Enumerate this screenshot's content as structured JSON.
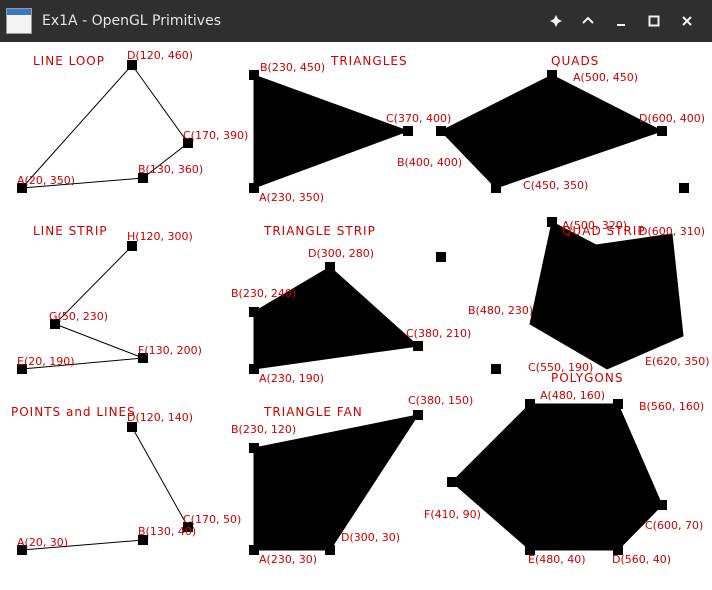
{
  "window": {
    "title": "Ex1A - OpenGL Primitives",
    "controls": [
      "pin",
      "minimize-up",
      "minimize",
      "maximize",
      "close"
    ],
    "colors": {
      "titlebar": "#2f2f2f",
      "label": "#cc0000",
      "shape": "#000000"
    }
  },
  "scene": {
    "titles": {
      "line_loop": "LINE LOOP",
      "triangles": "TRIANGLES",
      "quads": "QUADS",
      "line_strip": "LINE STRIP",
      "triangle_strip": "TRIANGLE STRIP",
      "quad_strip": "QUAD STRIP",
      "points_lines": "POINTS and LINES",
      "triangle_fan": "TRIANGLE FAN",
      "polygons": "POLYGONS"
    },
    "labels": {
      "ll_d": "D(120, 460)",
      "ll_c": "C(170, 390)",
      "ll_b": "B(130, 360)",
      "ll_a": "A(20, 350)",
      "tr_b": "B(230, 450)",
      "tr_c": "C(370, 400)",
      "tr_a": "A(230, 350)",
      "q_a": "A(500, 450)",
      "q_d": "D(600, 400)",
      "q_b": "B(400, 400)",
      "q_c": "C(450, 350)",
      "ls_h": "H(120, 300)",
      "ls_g": "G(50, 230)",
      "ls_f": "F(130, 200)",
      "ls_e": "E(20, 190)",
      "ts_d": "D(300, 280)",
      "ts_b": "B(230, 240)",
      "ts_c": "C(380, 210)",
      "ts_a": "A(230, 190)",
      "qs_a": "A(500, 320)",
      "qs_d": "D(600, 310)",
      "qs_b": "B(480, 230)",
      "qs_c": "C(550, 190)",
      "qs_e": "E(620, 350)",
      "pl_d": "D(120, 140)",
      "pl_c": "C(170, 50)",
      "pl_b": "B(130, 40)",
      "pl_a": "A(20, 30)",
      "tf_c": "C(380, 150)",
      "tf_b": "B(230, 120)",
      "tf_d": "D(300, 30)",
      "tf_a": "A(230, 30)",
      "pg_a": "A(480, 160)",
      "pg_b": "B(560, 160)",
      "pg_f": "F(410, 90)",
      "pg_c": "C(600, 70)",
      "pg_e": "E(480, 40)",
      "pg_d": "D(560, 40)"
    }
  }
}
